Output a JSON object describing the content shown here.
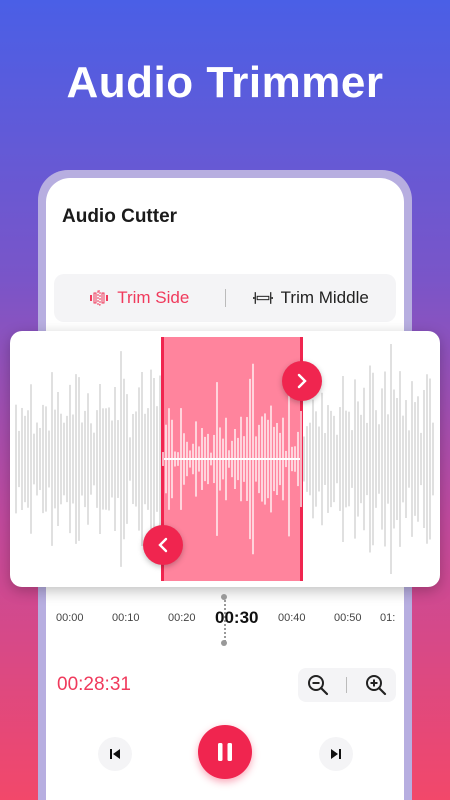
{
  "hero": {
    "title": "Audio Trimmer"
  },
  "app": {
    "title": "Audio Cutter"
  },
  "modes": [
    {
      "label": "Trim Side",
      "active": true,
      "icon": "trim-side-icon"
    },
    {
      "label": "Trim Middle",
      "active": false,
      "icon": "trim-middle-icon"
    }
  ],
  "timeline": {
    "ticks": [
      "00:00",
      "00:10",
      "00:20",
      "00:30",
      "00:40",
      "00:50",
      "01:"
    ],
    "current_tick": "00:30"
  },
  "playback": {
    "current_time": "00:28:31"
  },
  "colors": {
    "accent": "#f0254f",
    "accent_text": "#f03a5c",
    "selection": "#ff6e8c"
  },
  "icons": {
    "selection_handle_right": "chevron-right-icon",
    "selection_handle_left": "chevron-left-icon",
    "zoom_out": "zoom-out-icon",
    "zoom_in": "zoom-in-icon",
    "previous": "skip-previous-icon",
    "pause": "pause-icon",
    "next": "skip-next-icon"
  }
}
